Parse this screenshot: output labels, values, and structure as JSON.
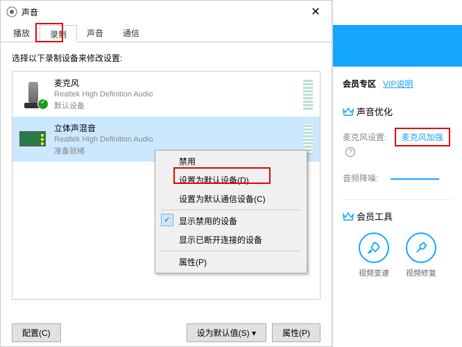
{
  "window": {
    "title": "声音",
    "close": "✕"
  },
  "tabs": [
    "播放",
    "录制",
    "声音",
    "通信"
  ],
  "selectedTab": 1,
  "instruction": "选择以下录制设备来修改设置:",
  "devices": [
    {
      "name": "麦克风",
      "desc": "Realtek High Definition Audio",
      "status": "默认设备",
      "default": true
    },
    {
      "name": "立体声混音",
      "desc": "Realtek High Definition Audio",
      "status": "准备就绪",
      "default": false
    }
  ],
  "contextMenu": {
    "disable": "禁用",
    "setDefault": "设置为默认设备(D)",
    "setDefaultComm": "设置为默认通信设备(C)",
    "showDisabled": "显示禁用的设备",
    "showDisconnected": "显示已断开连接的设备",
    "properties": "属性(P)"
  },
  "buttons": {
    "configure": "配置(C)",
    "setDefault": "设为默认值(S) ▾",
    "properties": "属性(P)"
  },
  "side": {
    "vipSection": "会员专区",
    "vipLink": "VIP说明",
    "soundOpt": "声音优化",
    "micSetting": "麦克风设置:",
    "micBoost": "麦克风加强",
    "noiseReduce": "音频降噪:",
    "vipTools": "会员工具",
    "tool1": "视频变速",
    "tool2": "视频修复"
  }
}
